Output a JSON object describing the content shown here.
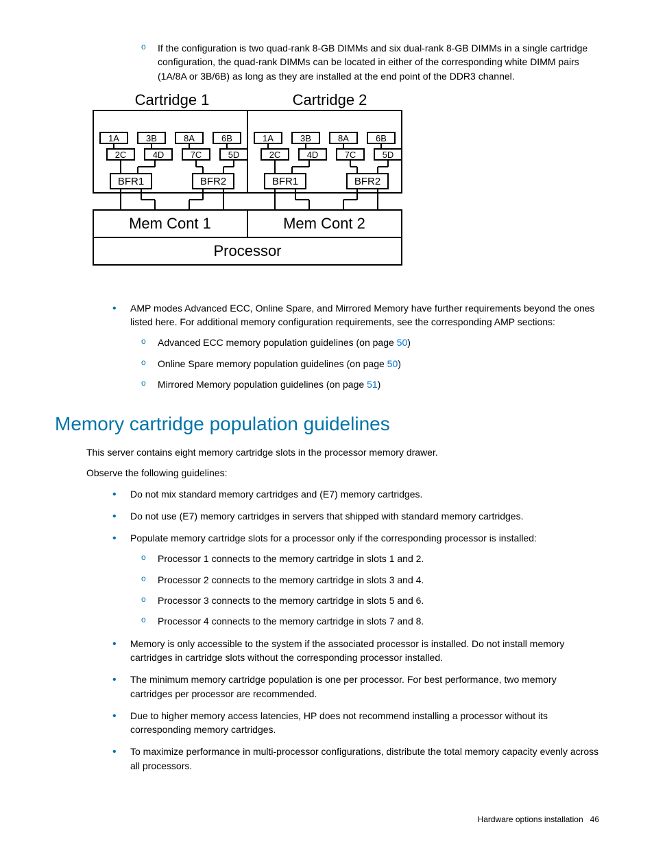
{
  "top_sublist_item": "If the configuration is two quad-rank 8-GB DIMMs and six dual-rank 8-GB DIMMs in a single cartridge configuration, the quad-rank DIMMs can be located in either of the corresponding white DIMM pairs (1A/8A or 3B/6B) as long as they are installed at the end point of the DDR3 channel.",
  "diagram": {
    "cart1": "Cartridge 1",
    "cart2": "Cartridge 2",
    "slots_top": [
      "1A",
      "3B",
      "8A",
      "6B"
    ],
    "slots_bottom": [
      "2C",
      "4D",
      "7C",
      "5D"
    ],
    "bfr1": "BFR1",
    "bfr2": "BFR2",
    "mem1": "Mem Cont 1",
    "mem2": "Mem Cont 2",
    "processor": "Processor"
  },
  "amp_intro": "AMP modes Advanced ECC, Online Spare, and Mirrored Memory have further requirements beyond the ones listed here. For additional memory configuration requirements, see the corresponding AMP sections:",
  "amp_list": [
    {
      "text_a": "Advanced ECC memory population guidelines (on page ",
      "link": "50",
      "text_b": ")"
    },
    {
      "text_a": "Online Spare memory population guidelines (on page ",
      "link": "50",
      "text_b": ")"
    },
    {
      "text_a": "Mirrored Memory population guidelines (on page ",
      "link": "51",
      "text_b": ")"
    }
  ],
  "heading": "Memory cartridge population guidelines",
  "intro1": "This server contains eight memory cartridge slots in the processor memory drawer.",
  "intro2": "Observe the following guidelines:",
  "guidelines": [
    "Do not mix standard memory cartridges and (E7) memory cartridges.",
    "Do not use (E7) memory cartridges in servers that shipped with standard memory cartridges.",
    "Populate memory cartridge slots for a processor only if the corresponding processor is installed:",
    "Memory is only accessible to the system if the associated processor is installed. Do not install memory cartridges in cartridge slots without the corresponding processor installed.",
    "The minimum memory cartridge population is one per processor. For best performance, two memory cartridges per processor are recommended.",
    "Due to higher memory access latencies, HP does not recommend installing a processor without its corresponding memory cartridges.",
    "To maximize performance in multi-processor configurations, distribute the total memory capacity evenly across all processors."
  ],
  "processor_map": [
    "Processor 1 connects to the memory cartridge in slots 1 and 2.",
    "Processor 2 connects to the memory cartridge in slots 3 and 4.",
    "Processor 3 connects to the memory cartridge in slots 5 and 6.",
    "Processor 4 connects to the memory cartridge in slots 7 and 8."
  ],
  "footer_section": "Hardware options installation",
  "footer_page": "46"
}
